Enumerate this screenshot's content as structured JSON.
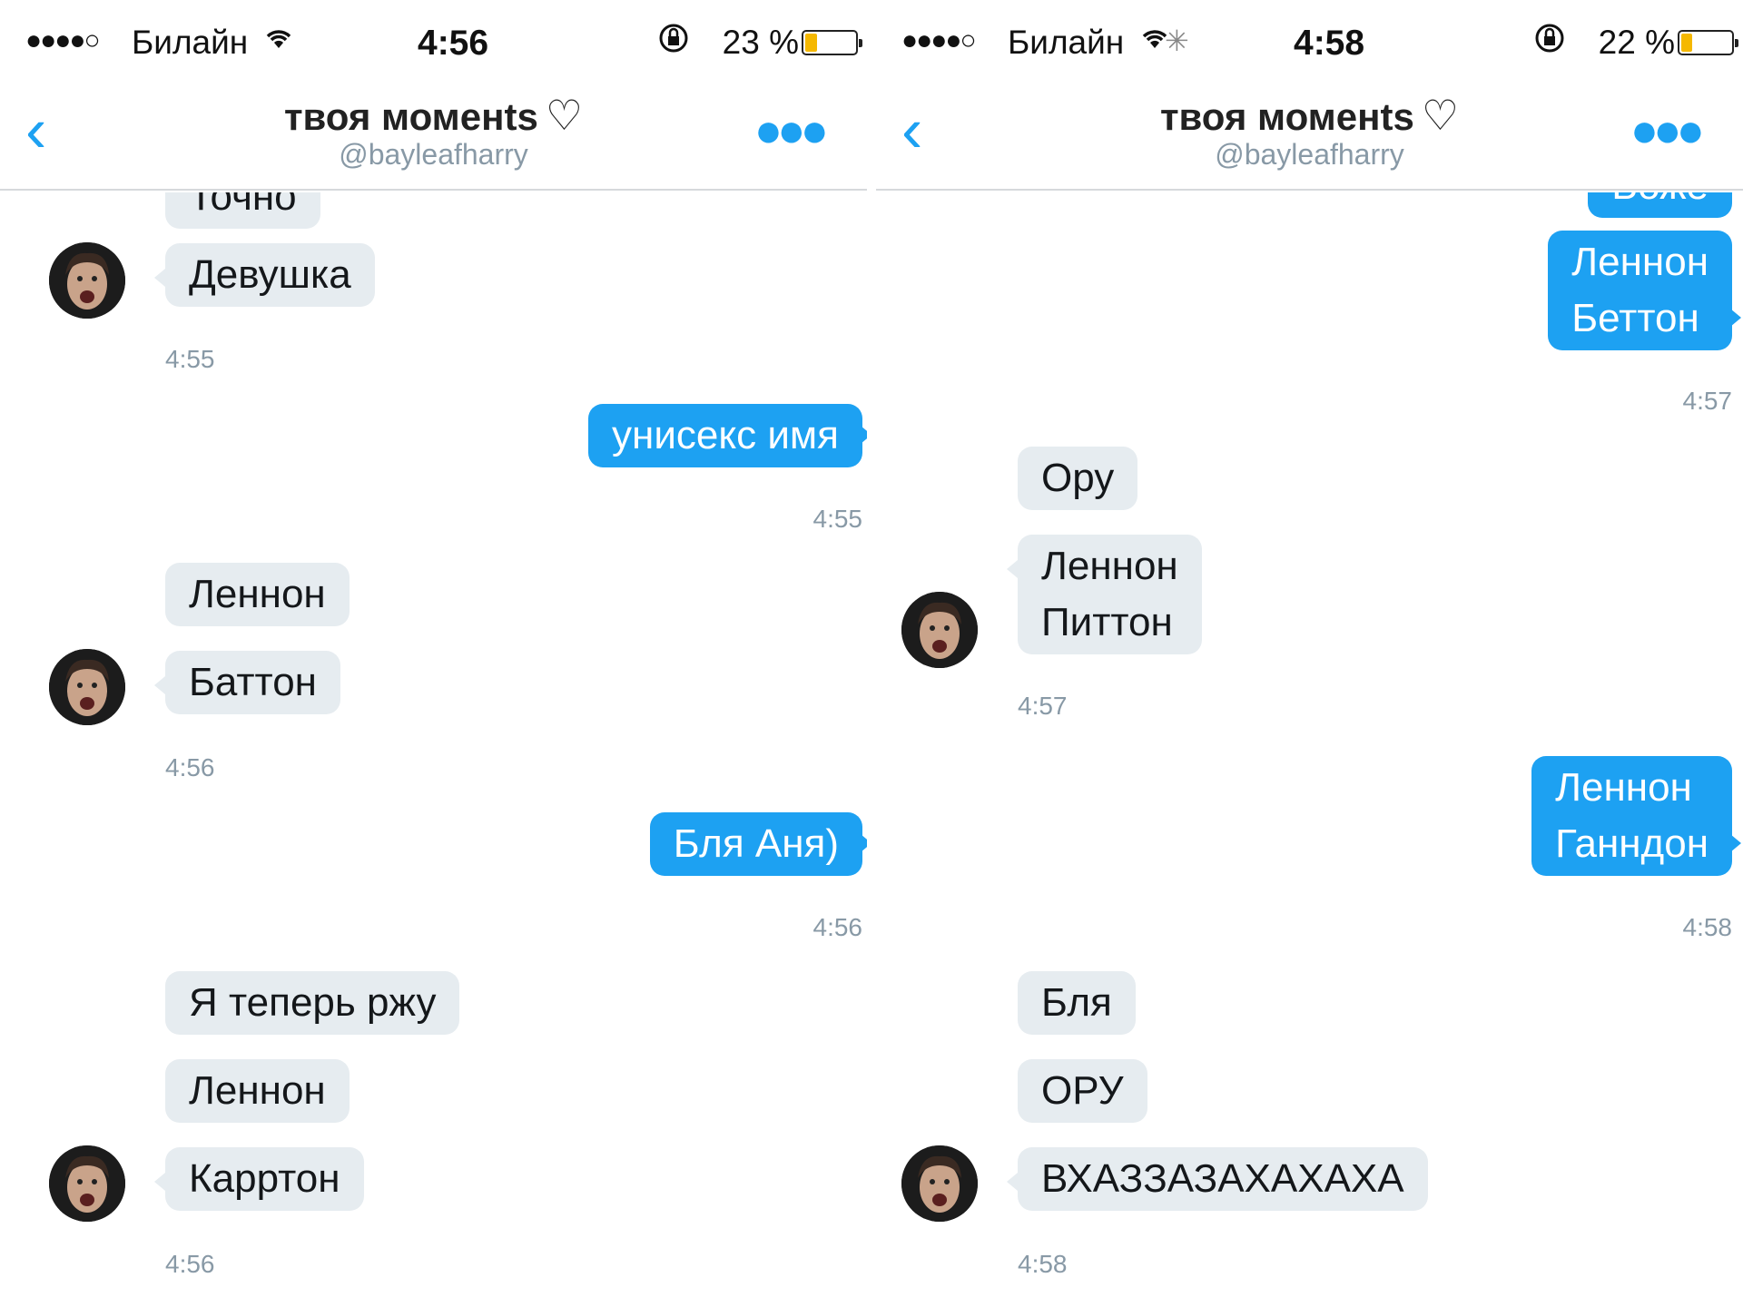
{
  "left": {
    "status": {
      "signal": "●●●●○",
      "carrier": "Билайн",
      "wifi": "wifi-icon",
      "time": "4:56",
      "battery_text": "23 %",
      "battery_level": 0.23
    },
    "nav": {
      "title": "твоя моменts",
      "handle": "@bayleafharry"
    },
    "messages": [
      {
        "dir": "in",
        "text": "Точно"
      },
      {
        "dir": "in",
        "text": "Девушка"
      },
      {
        "ts": "4:55"
      },
      {
        "dir": "out",
        "text": "унисекс имя"
      },
      {
        "ts": "4:55"
      },
      {
        "dir": "in",
        "text": "Леннон"
      },
      {
        "dir": "in",
        "text": "Баттон"
      },
      {
        "ts": "4:56"
      },
      {
        "dir": "out",
        "text": "Бля Аня)"
      },
      {
        "ts": "4:56"
      },
      {
        "dir": "in",
        "text": "Я теперь ржу"
      },
      {
        "dir": "in",
        "text": "Леннон"
      },
      {
        "dir": "in",
        "text": "Карртон"
      },
      {
        "ts": "4:56"
      }
    ]
  },
  "right": {
    "status": {
      "signal": "●●●●○",
      "carrier": "Билайн",
      "wifi": "wifi-icon",
      "time": "4:58",
      "battery_text": "22 %",
      "battery_level": 0.22
    },
    "nav": {
      "title": "твоя моменts",
      "handle": "@bayleafharry"
    },
    "messages": [
      {
        "dir": "out",
        "text": "Боже"
      },
      {
        "dir": "out",
        "text": "Леннон\nБеттон"
      },
      {
        "ts": "4:57"
      },
      {
        "dir": "in",
        "text": "Ору"
      },
      {
        "dir": "in",
        "text": "Леннон\nПиттон"
      },
      {
        "ts": "4:57"
      },
      {
        "dir": "out",
        "text": "Леннон\nГанндон"
      },
      {
        "ts": "4:58"
      },
      {
        "dir": "in",
        "text": "Бля"
      },
      {
        "dir": "in",
        "text": "ОРУ"
      },
      {
        "dir": "in",
        "text": "ВХАЗЗАЗАХАХАХА"
      },
      {
        "ts": "4:58"
      }
    ]
  },
  "colors": {
    "accent": "#1da1f2",
    "incoming_bubble": "#e6ecf0",
    "timestamp": "#8899a6",
    "battery": "#f5b800"
  },
  "icons": {
    "back": "chevron-left-icon",
    "more": "more-dots-icon",
    "heart": "heart-outline-icon",
    "lock": "rotation-lock-icon"
  }
}
